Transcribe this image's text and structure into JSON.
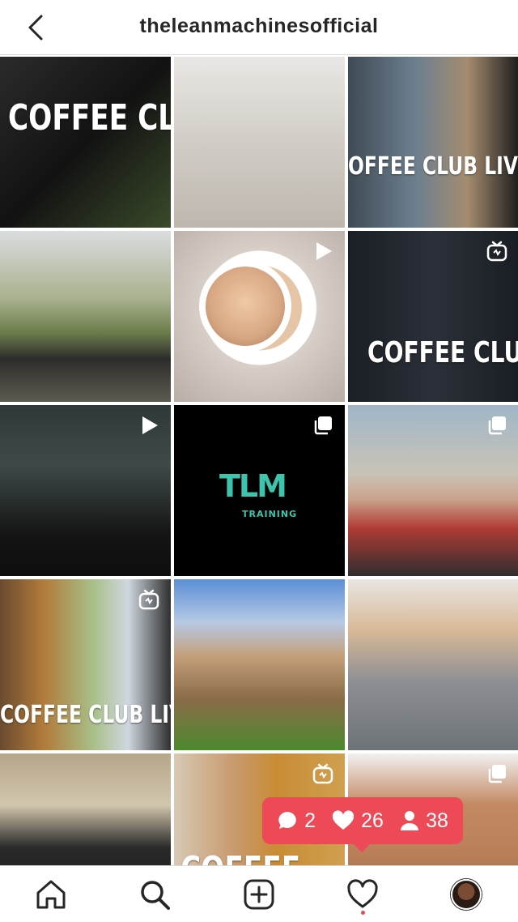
{
  "header": {
    "username": "theleanmachinesofficial",
    "back_icon": "chevron-left-icon"
  },
  "tiles": [
    {
      "name": "post-coffee-club-1",
      "overlay": "COFFEE CLUB",
      "badge": ""
    },
    {
      "name": "post-dumbbell-bench",
      "overlay": "",
      "badge": ""
    },
    {
      "name": "post-coffee-club-live-1",
      "overlay": "OFFEE CLUB LIVE",
      "badge": ""
    },
    {
      "name": "post-bench-duo",
      "overlay": "",
      "badge": ""
    },
    {
      "name": "post-tube-face",
      "overlay": "",
      "badge": "video-icon"
    },
    {
      "name": "post-coffee-club-2",
      "overlay": "COFFEE CLUB",
      "badge": "igtv-icon"
    },
    {
      "name": "post-nocco-talk",
      "overlay": "",
      "badge": "video-icon"
    },
    {
      "name": "post-tlm-training",
      "overlay": "",
      "badge": "carousel-icon"
    },
    {
      "name": "post-garden-shirtless",
      "overlay": "",
      "badge": "carousel-icon"
    },
    {
      "name": "post-coffee-club-live-2",
      "overlay": "COFFEE CLUB LIVE",
      "badge": "igtv-icon"
    },
    {
      "name": "post-garden-group",
      "overlay": "",
      "badge": ""
    },
    {
      "name": "post-headband",
      "overlay": "",
      "badge": ""
    },
    {
      "name": "post-dumbbell-squat",
      "overlay": "",
      "badge": ""
    },
    {
      "name": "post-coffee-club-3",
      "overlay": "COFFEE",
      "badge": "igtv-icon"
    },
    {
      "name": "post-brick-wall",
      "overlay": "",
      "badge": "carousel-icon"
    }
  ],
  "tlm_logo": {
    "mark": "TLM",
    "sub": "TRAINING",
    "color": "#3dc4ad"
  },
  "notification": {
    "comments": "2",
    "likes": "26",
    "follows": "38",
    "color": "#ed4956"
  },
  "nav": {
    "items": [
      "home-icon",
      "search-icon",
      "new-post-icon",
      "activity-icon",
      "profile-avatar"
    ]
  }
}
